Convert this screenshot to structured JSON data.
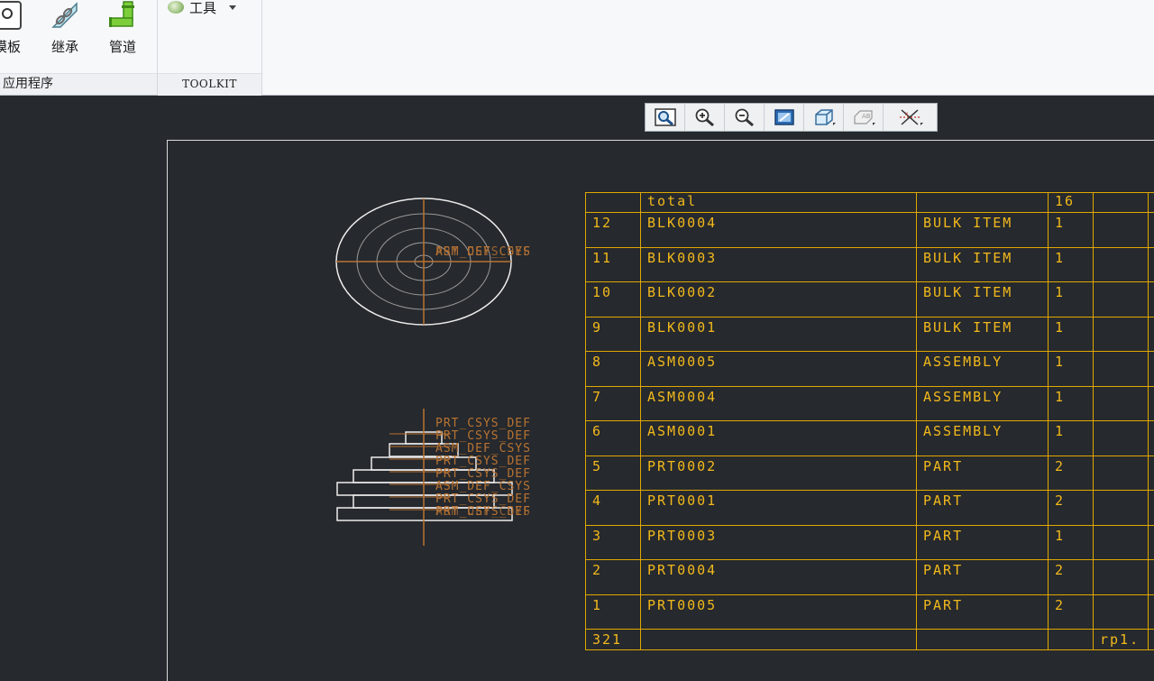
{
  "ribbon": {
    "applications_group": {
      "label": "应用程序",
      "buttons": [
        {
          "id": "template",
          "label": "模板"
        },
        {
          "id": "inherit",
          "label": "继承"
        },
        {
          "id": "pipe",
          "label": "管道"
        }
      ]
    },
    "toolkit_group": {
      "label": "TOOLKIT",
      "tools_menu_label": "工具"
    }
  },
  "graphics_toolbar": {
    "tools": [
      "refit-icon",
      "zoom-in-icon",
      "zoom-out-icon",
      "repaint-icon",
      "display-style-icon",
      "annotation-display-icon",
      "datum-display-icon"
    ]
  },
  "drawing": {
    "csys_labels": {
      "top_view": [
        "ASM_DEF_CSYS",
        "PRT_CSYS_DEF"
      ],
      "stack_view": [
        "PRT_CSYS_DEF",
        "PRT_CSYS_DEF",
        "ASM_DEF_CSYS",
        "PRT_CSYS_DEF",
        "PRT_CSYS_DEF",
        "ASM_DEF_CSYS",
        "PRT_CSYS_DEF",
        "PRT_CSYS_DEF",
        "ASM_DEF_CSYS"
      ]
    },
    "colors": {
      "background": "#26292d",
      "table": "#e0a800",
      "table_text": "#f2b91c",
      "geometry": "#e8e8e8",
      "datum": "#b87333"
    }
  },
  "bom": {
    "header": {
      "name": "total",
      "qty": "16"
    },
    "rows": [
      {
        "index": "12",
        "name": "BLK0004",
        "type": "BULK ITEM",
        "qty": "1"
      },
      {
        "index": "11",
        "name": "BLK0003",
        "type": "BULK ITEM",
        "qty": "1"
      },
      {
        "index": "10",
        "name": "BLK0002",
        "type": "BULK ITEM",
        "qty": "1"
      },
      {
        "index": "9",
        "name": "BLK0001",
        "type": "BULK ITEM",
        "qty": "1"
      },
      {
        "index": "8",
        "name": "ASM0005",
        "type": "ASSEMBLY",
        "qty": "1"
      },
      {
        "index": "7",
        "name": "ASM0004",
        "type": "ASSEMBLY",
        "qty": "1"
      },
      {
        "index": "6",
        "name": "ASM0001",
        "type": "ASSEMBLY",
        "qty": "1"
      },
      {
        "index": "5",
        "name": "PRT0002",
        "type": "PART",
        "qty": "2"
      },
      {
        "index": "4",
        "name": "PRT0001",
        "type": "PART",
        "qty": "2"
      },
      {
        "index": "3",
        "name": "PRT0003",
        "type": "PART",
        "qty": "1"
      },
      {
        "index": "2",
        "name": "PRT0004",
        "type": "PART",
        "qty": "2"
      },
      {
        "index": "1",
        "name": "PRT0005",
        "type": "PART",
        "qty": "2"
      }
    ],
    "footer": {
      "index": "321",
      "note": "rp1."
    }
  }
}
